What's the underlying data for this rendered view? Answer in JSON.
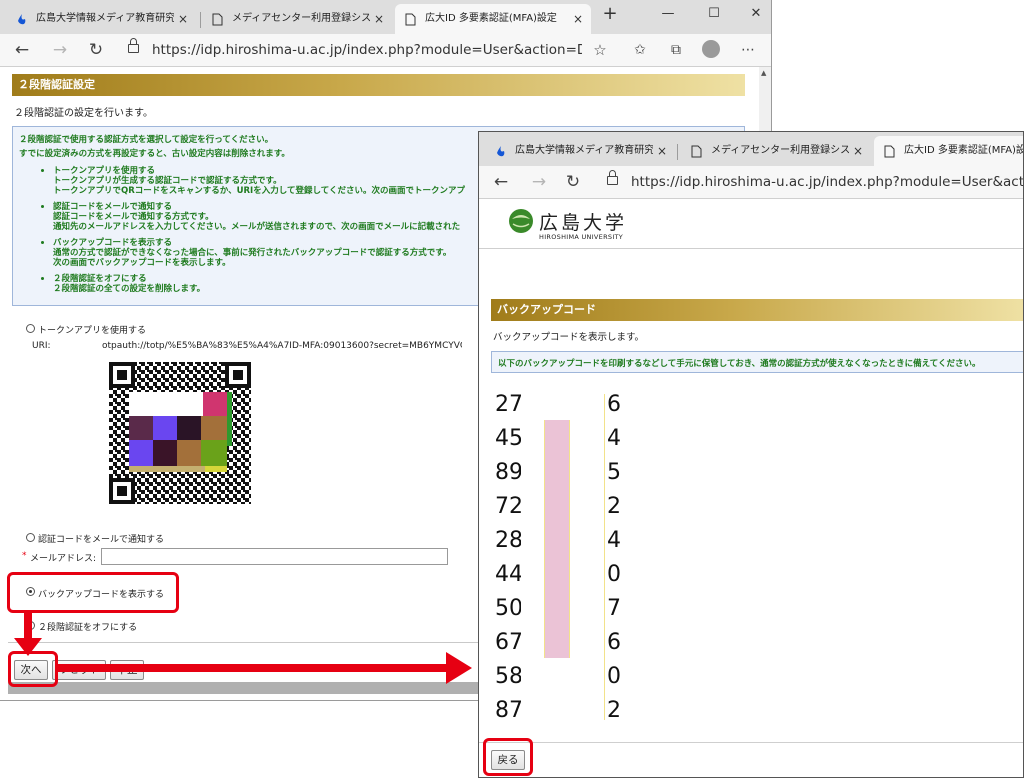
{
  "window1": {
    "tabs": [
      {
        "title": "広島大学情報メディア教育研究センタ"
      },
      {
        "title": "メディアセンター利用登録システム"
      },
      {
        "title": "広大ID 多要素認証(MFA)設定"
      }
    ],
    "tab_close": "×",
    "new_tab": "+",
    "controls": {
      "minimize": "—",
      "maximize": "☐",
      "close": "✕"
    },
    "url": "https://idp.hiroshima-u.ac.jp/index.php?module=User&action=DisplayE...",
    "heading": "２段階認証設定",
    "intro": "２段階認証の設定を行います。",
    "notice": {
      "line1": "２段階認証で使用する認証方式を選択して設定を行ってください。",
      "line2": "すでに設定済みの方式を再設定すると、古い設定内容は削除されます。",
      "items": [
        {
          "title": "トークンアプリを使用する",
          "lines": [
            "トークンアプリが生成する認証コードで認証する方式です。",
            "トークンアプリでQRコードをスキャンするか、URIを入力して登録してください。次の画面でトークンアプ"
          ]
        },
        {
          "title": "認証コードをメールで通知する",
          "lines": [
            "認証コードをメールで通知する方式です。",
            "通知先のメールアドレスを入力してください。メールが送信されますので、次の画面でメールに記載された"
          ]
        },
        {
          "title": "バックアップコードを表示する",
          "lines": [
            "通常の方式で認証ができなくなった場合に、事前に発行されたバックアップコードで認証する方式です。",
            "次の画面でバックアップコードを表示します。"
          ]
        },
        {
          "title": "２段階認証をオフにする",
          "lines": [
            "２段階認証の全ての設定を削除します。"
          ]
        }
      ]
    },
    "options": {
      "token_app": "トークンアプリを使用する",
      "uri_label": "URI:",
      "uri_value": "otpauth://totp/%E5%BA%83%E5%A4%A7ID-MFA:09013600?secret=MB6YMCYVG",
      "email": "認証コードをメールで通知する",
      "email_label": "メールアドレス:",
      "email_required_mark": "*",
      "email_value": "",
      "backup": "バックアップコードを表示する",
      "off": "２段階認証をオフにする"
    },
    "buttons": {
      "next": "次へ",
      "reset": "リセット",
      "cancel": "中止"
    }
  },
  "window2": {
    "tabs": [
      {
        "title": "広島大学情報メディア教育研究セン"
      },
      {
        "title": "メディアセンター利用登録システム"
      },
      {
        "title": "広大ID 多要素認証(MFA)設定"
      }
    ],
    "tab_close": "×",
    "url": "https://idp.hiroshima-u.ac.jp/index.php?module=User&action=Displ",
    "logo": {
      "jp": "広島大学",
      "en": "HIROSHIMA UNIVERSITY"
    },
    "heading": "バックアップコード",
    "intro": "バックアップコードを表示します。",
    "notice": "以下のバックアップコードを印刷するなどして手元に保管しておき、通常の認証方式が使えなくなったときに備えてください。",
    "codes": [
      {
        "start": "27",
        "end": "6"
      },
      {
        "start": "45",
        "end": "4"
      },
      {
        "start": "89",
        "end": "5"
      },
      {
        "start": "72",
        "end": "2"
      },
      {
        "start": "28",
        "end": "4"
      },
      {
        "start": "44",
        "end": "0"
      },
      {
        "start": "50",
        "end": "7"
      },
      {
        "start": "67",
        "end": "6"
      },
      {
        "start": "58",
        "end": "0"
      },
      {
        "start": "87",
        "end": "2"
      }
    ],
    "back_button": "戻る"
  },
  "colors": {
    "highlight": "#e60012",
    "heading_gold": "#a07c1a",
    "notice_green": "#1f7b1f"
  }
}
